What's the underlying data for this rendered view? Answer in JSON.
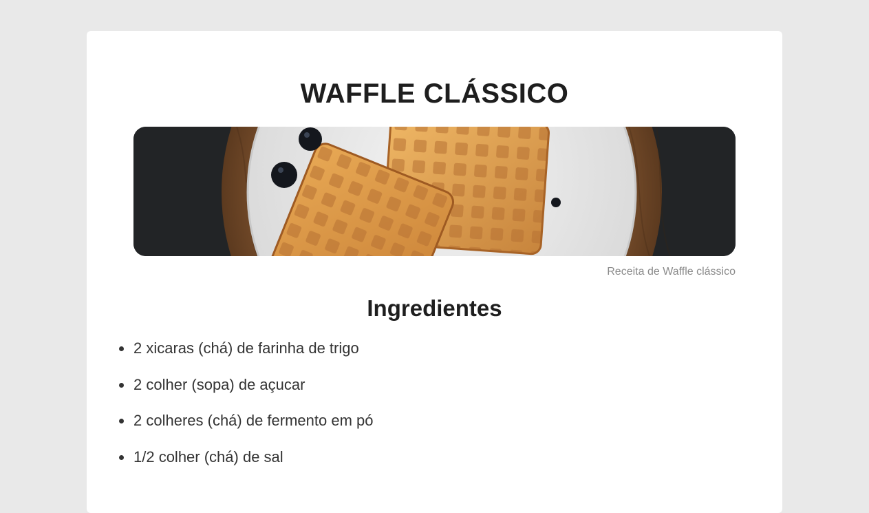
{
  "recipe": {
    "title": "WAFFLE CLÁSSICO",
    "image_caption": "Receita de Waffle clássico",
    "ingredients_heading": "Ingredientes",
    "ingredients": [
      "2 xicaras (chá) de farinha de trigo",
      "2 colher (sopa) de açucar",
      "2 colheres (chá) de fermento em pó",
      "1/2 colher (chá) de sal"
    ]
  },
  "colors": {
    "page_background": "#e9e9e9",
    "card_background": "#ffffff",
    "title_text": "#1e1e1e",
    "caption_text": "#8a8a8a",
    "waffle": "#e0a55a"
  }
}
